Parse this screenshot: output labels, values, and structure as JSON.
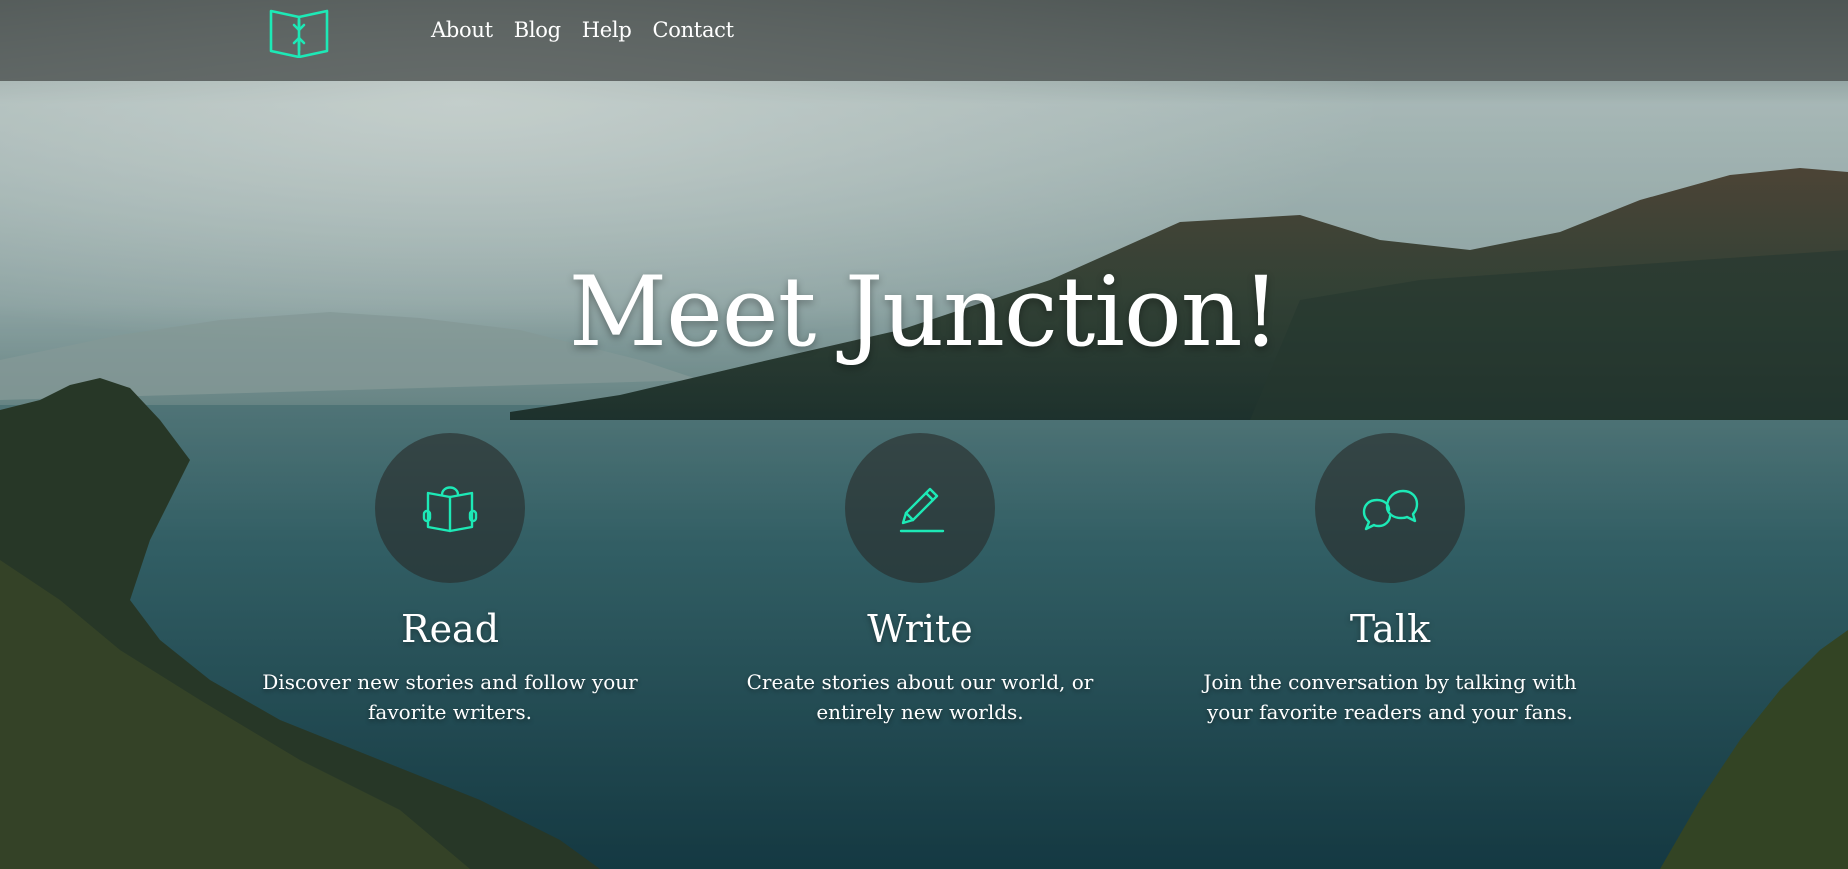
{
  "theme": {
    "accent": "#1de9b6",
    "navbar_bg": "#4a504e",
    "text": "#ffffff"
  },
  "nav": {
    "logo_icon": "open-book-arrows-icon",
    "links": [
      {
        "label": "About"
      },
      {
        "label": "Blog"
      },
      {
        "label": "Help"
      },
      {
        "label": "Contact"
      }
    ]
  },
  "hero": {
    "title": "Meet Junction!"
  },
  "features": [
    {
      "icon": "reading-book-icon",
      "title": "Read",
      "description": "Discover new stories and follow your favorite writers."
    },
    {
      "icon": "pencil-icon",
      "title": "Write",
      "description": "Create stories about our world, or entirely new worlds."
    },
    {
      "icon": "chat-bubbles-icon",
      "title": "Talk",
      "description": "Join the conversation by talking with your favorite readers and your fans."
    }
  ]
}
